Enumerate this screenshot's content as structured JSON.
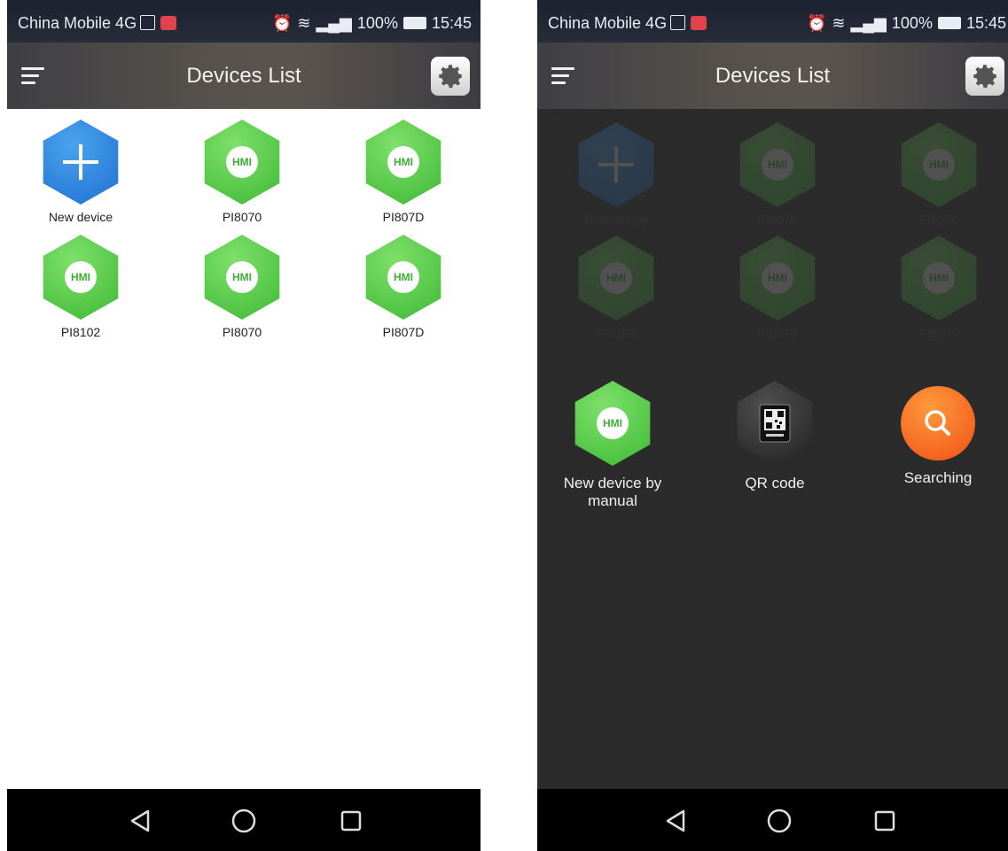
{
  "status_bar": {
    "carrier": "China Mobile 4G",
    "battery": "100%",
    "time": "15:45",
    "network": "4G"
  },
  "app_bar": {
    "title": "Devices List"
  },
  "devices": [
    {
      "label": "New device",
      "icon": "plus-icon"
    },
    {
      "label": "PI8070",
      "badge": "HMI"
    },
    {
      "label": "PI807D",
      "badge": "HMI"
    },
    {
      "label": "PI8102",
      "badge": "HMI"
    },
    {
      "label": "PI8070",
      "badge": "HMI"
    },
    {
      "label": "PI807D",
      "badge": "HMI"
    }
  ],
  "right_devices": [
    {
      "label": "New device"
    },
    {
      "label": "PI8070",
      "badge": "HMI"
    },
    {
      "label": "PI8070",
      "badge": "HMI"
    },
    {
      "label": "PI8102",
      "badge": "HMI"
    },
    {
      "label": "PI8070",
      "badge": "HMI"
    },
    {
      "label": "PI8070",
      "badge": "HMI"
    }
  ],
  "add_menu": {
    "manual": {
      "label": "New device by manual",
      "badge": "HMI"
    },
    "qr": {
      "label": "QR code"
    },
    "search": {
      "label": "Searching"
    }
  },
  "colors": {
    "accent_green": "#3cb834",
    "accent_blue": "#1d6fd0",
    "search_orange": "#ef4f16"
  }
}
